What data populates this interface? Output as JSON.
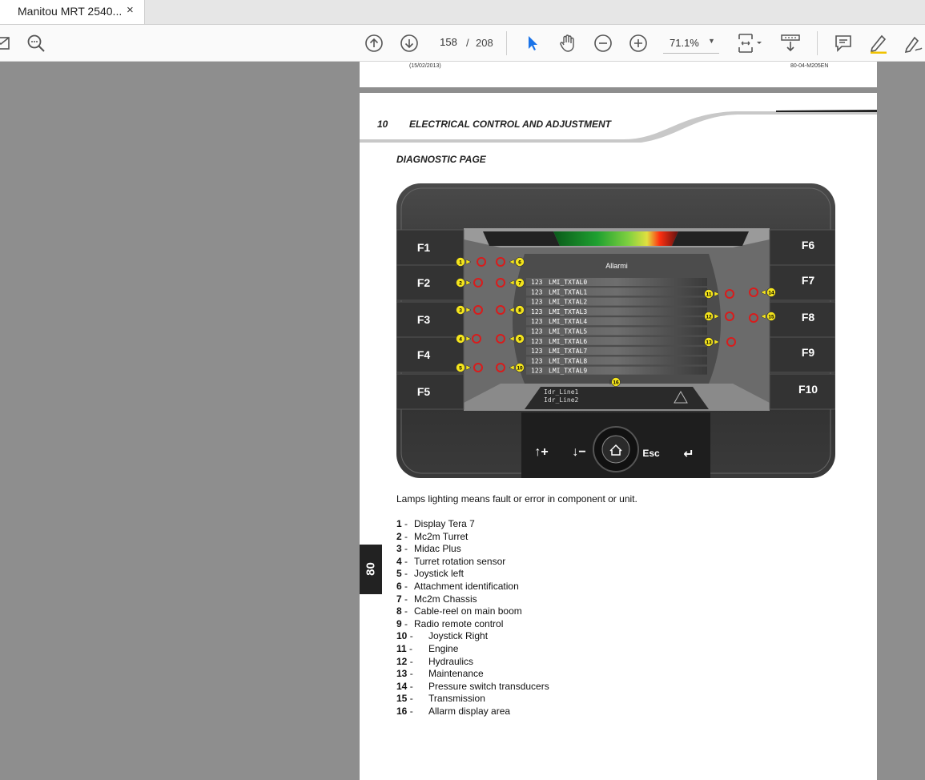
{
  "tab": {
    "title": "Manitou MRT 2540...",
    "close": "×"
  },
  "toolbar": {
    "page_current": "158",
    "page_separator": "/",
    "page_total": "208",
    "zoom": "71.1%"
  },
  "prev_page": {
    "date": "(15/02/2013)",
    "code": "80-04-M205EN"
  },
  "page": {
    "section_number": "10",
    "section_title": "ELECTRICAL CONTROL AND ADJUSTMENT",
    "subheading": "DIAGNOSTIC PAGE",
    "side_tab": "80",
    "intro": "Lamps lighting means fault or error in component or unit.",
    "legend": [
      {
        "num": "1",
        "sep": " - ",
        "text": "Display Tera 7"
      },
      {
        "num": "2",
        "sep": " - ",
        "text": "Mc2m Turret"
      },
      {
        "num": "3",
        "sep": " - ",
        "text": "Midac Plus"
      },
      {
        "num": "4",
        "sep": " - ",
        "text": "Turret rotation sensor"
      },
      {
        "num": "5",
        "sep": " - ",
        "text": "Joystick left"
      },
      {
        "num": "6",
        "sep": " - ",
        "text": "Attachment identification"
      },
      {
        "num": "7",
        "sep": " - ",
        "text": "Mc2m Chassis"
      },
      {
        "num": "8",
        "sep": " - ",
        "text": "Cable-reel on main boom"
      },
      {
        "num": "9",
        "sep": " - ",
        "text": "Radio remote control"
      },
      {
        "num": "10",
        "sep": " - ",
        "text": "Joystick Right"
      },
      {
        "num": "11",
        "sep": " - ",
        "text": "Engine"
      },
      {
        "num": "12",
        "sep": " - ",
        "text": "Hydraulics"
      },
      {
        "num": "13",
        "sep": " - ",
        "text": "Maintenance"
      },
      {
        "num": "14",
        "sep": " - ",
        "text": "Pressure switch transducers"
      },
      {
        "num": "15",
        "sep": " - ",
        "text": "Transmission"
      },
      {
        "num": "16",
        "sep": " - ",
        "text": "Allarm display area"
      }
    ]
  },
  "display": {
    "fkeys_left": [
      "F1",
      "F2",
      "F3",
      "F4",
      "F5"
    ],
    "fkeys_right": [
      "F6",
      "F7",
      "F8",
      "F9",
      "F10"
    ],
    "alarm_title": "Allarmi",
    "alarm_rows": [
      "LMI_TXTAL0",
      "LMI_TXTAL1",
      "LMI_TXTAL2",
      "LMI_TXTAL3",
      "LMI_TXTAL4",
      "LMI_TXTAL5",
      "LMI_TXTAL6",
      "LMI_TXTAL7",
      "LMI_TXTAL8",
      "LMI_TXTAL9"
    ],
    "alarm_code": "123",
    "info_lines": [
      "Idr_Line1",
      "Idr_Line2"
    ],
    "esc_label": "Esc",
    "callouts_left": [
      "1",
      "2",
      "3",
      "4",
      "5"
    ],
    "callouts_mid": [
      "6",
      "7",
      "8",
      "9",
      "10"
    ],
    "callouts_right": [
      "11",
      "12",
      "13"
    ],
    "callouts_far": [
      "14",
      "15"
    ],
    "callout_bottom": "16"
  }
}
